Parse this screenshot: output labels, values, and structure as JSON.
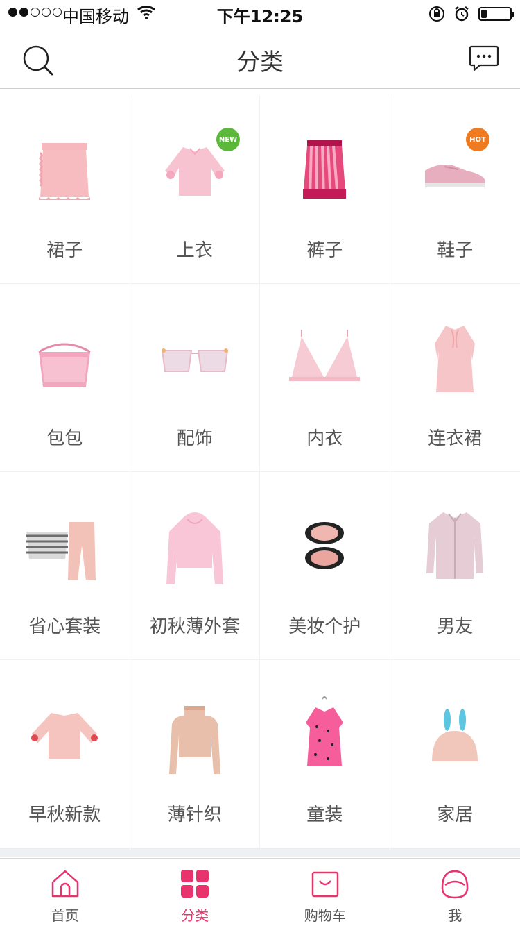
{
  "status_bar": {
    "carrier": "中国移动",
    "time": "下午12:25",
    "signal_strength": 2,
    "battery_level": 0.2
  },
  "nav": {
    "title": "分类",
    "left_icon": "search-icon",
    "right_icon": "message-icon"
  },
  "categories": [
    {
      "label": "裙子",
      "icon": "skirt",
      "badge": ""
    },
    {
      "label": "上衣",
      "icon": "top",
      "badge": "NEW"
    },
    {
      "label": "裤子",
      "icon": "pleated-skirt",
      "badge": ""
    },
    {
      "label": "鞋子",
      "icon": "sneaker",
      "badge": "HOT"
    },
    {
      "label": "包包",
      "icon": "handbag",
      "badge": ""
    },
    {
      "label": "配饰",
      "icon": "sunglasses",
      "badge": ""
    },
    {
      "label": "内衣",
      "icon": "bra",
      "badge": ""
    },
    {
      "label": "连衣裙",
      "icon": "dress",
      "badge": ""
    },
    {
      "label": "省心套装",
      "icon": "outfit-set",
      "badge": ""
    },
    {
      "label": "初秋薄外套",
      "icon": "hoodie",
      "badge": ""
    },
    {
      "label": "美妆个护",
      "icon": "compact",
      "badge": ""
    },
    {
      "label": "男友",
      "icon": "shirt",
      "badge": ""
    },
    {
      "label": "早秋新款",
      "icon": "blouse",
      "badge": ""
    },
    {
      "label": "薄针织",
      "icon": "knit-top",
      "badge": ""
    },
    {
      "label": "童装",
      "icon": "kids-dress",
      "badge": ""
    },
    {
      "label": "家居",
      "icon": "bunny-lamp",
      "badge": ""
    }
  ],
  "tabs": [
    {
      "label": "首页",
      "icon": "home-icon",
      "active": false
    },
    {
      "label": "分类",
      "icon": "category-grid-icon",
      "active": true
    },
    {
      "label": "购物车",
      "icon": "shopping-bag-icon",
      "active": false
    },
    {
      "label": "我",
      "icon": "user-icon",
      "active": false
    }
  ],
  "colors": {
    "accent": "#e8336d",
    "text": "#333333",
    "label": "#555555",
    "badge_new": "#5cb83a",
    "badge_hot": "#f07a20"
  }
}
